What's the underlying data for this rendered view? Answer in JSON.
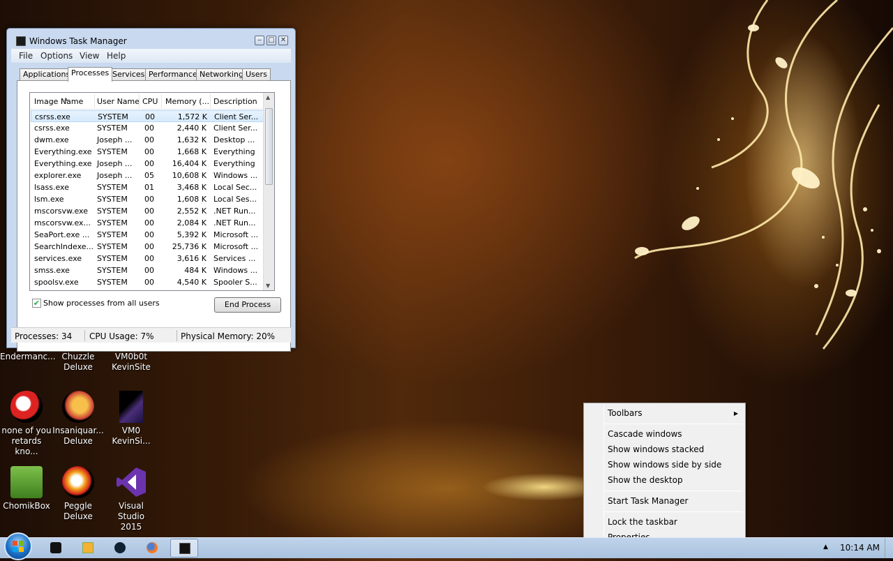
{
  "window": {
    "title": "Windows Task Manager",
    "controls": {
      "minimize": "‒",
      "maximize": "□",
      "close": "✕"
    },
    "menu": [
      "File",
      "Options",
      "View",
      "Help"
    ],
    "tabs": [
      "Applications",
      "Processes",
      "Services",
      "Performance",
      "Networking",
      "Users"
    ],
    "active_tab": "Processes"
  },
  "process_list": {
    "columns": [
      "Image Name",
      "User Name",
      "CPU",
      "Memory (...",
      "Description"
    ],
    "rows": [
      [
        "csrss.exe",
        "SYSTEM",
        "00",
        "1,572 K",
        "Client Ser..."
      ],
      [
        "csrss.exe",
        "SYSTEM",
        "00",
        "2,440 K",
        "Client Ser..."
      ],
      [
        "dwm.exe",
        "Joseph ...",
        "00",
        "1,632 K",
        "Desktop ..."
      ],
      [
        "Everything.exe",
        "SYSTEM",
        "00",
        "1,668 K",
        "Everything"
      ],
      [
        "Everything.exe",
        "Joseph ...",
        "00",
        "16,404 K",
        "Everything"
      ],
      [
        "explorer.exe",
        "Joseph ...",
        "05",
        "10,608 K",
        "Windows ..."
      ],
      [
        "lsass.exe",
        "SYSTEM",
        "01",
        "3,468 K",
        "Local Sec..."
      ],
      [
        "lsm.exe",
        "SYSTEM",
        "00",
        "1,608 K",
        "Local Ses..."
      ],
      [
        "mscorsvw.exe",
        "SYSTEM",
        "00",
        "2,552 K",
        ".NET Run..."
      ],
      [
        "mscorsvw.ex...",
        "SYSTEM",
        "00",
        "2,084 K",
        ".NET Run..."
      ],
      [
        "SeaPort.exe ...",
        "SYSTEM",
        "00",
        "5,392 K",
        "Microsoft ..."
      ],
      [
        "SearchIndexe...",
        "SYSTEM",
        "00",
        "25,736 K",
        "Microsoft ..."
      ],
      [
        "services.exe",
        "SYSTEM",
        "00",
        "3,616 K",
        "Services ..."
      ],
      [
        "smss.exe",
        "SYSTEM",
        "00",
        "484 K",
        "Windows ..."
      ],
      [
        "spoolsv.exe",
        "SYSTEM",
        "00",
        "4,540 K",
        "Spooler S..."
      ]
    ],
    "selected_row": 0
  },
  "controls": {
    "show_all_label": "Show processes from all users",
    "show_all_checked": true,
    "end_process_label": "End Process"
  },
  "status": {
    "processes": "Processes: 34",
    "cpu": "CPU Usage: 7%",
    "memory": "Physical Memory: 20%"
  },
  "desktop_icons": [
    {
      "label": "Endermanc...",
      "icon": "game-icon"
    },
    {
      "label": "Chuzzle\nDeluxe",
      "icon": "chuzzle-icon"
    },
    {
      "label": "VM0b0t\nKevinSite",
      "icon": "vm-icon"
    },
    {
      "label": "none of you\nretards kno...",
      "icon": "firefox-like-icon"
    },
    {
      "label": "Insaniquar...\nDeluxe",
      "icon": "insaniquarium-icon"
    },
    {
      "label": "VM0\nKevinSi...",
      "icon": "vm-icon"
    },
    {
      "label": "ChomikBox",
      "icon": "chomikbox-icon"
    },
    {
      "label": "Peggle\nDeluxe",
      "icon": "peggle-icon"
    },
    {
      "label": "Visual Studio\n2015",
      "icon": "visual-studio-icon"
    }
  ],
  "context_menu": {
    "items": [
      "Toolbars",
      "Cascade windows",
      "Show windows stacked",
      "Show windows side by side",
      "Show the desktop",
      "Start Task Manager",
      "Lock the taskbar",
      "Properties"
    ],
    "submenu_arrow": "▶",
    "lock_checked": false
  },
  "taskbar": {
    "pinned": [
      "app-icon",
      "media-player-icon",
      "steam-icon",
      "firefox-icon",
      "task-manager-icon"
    ],
    "tray_arrow": "▲",
    "clock": "10:14 AM"
  },
  "colors": {
    "title_bar": "#c9d9ef",
    "taskbar": "#b5cbe6",
    "selection": "#d6eafc"
  }
}
